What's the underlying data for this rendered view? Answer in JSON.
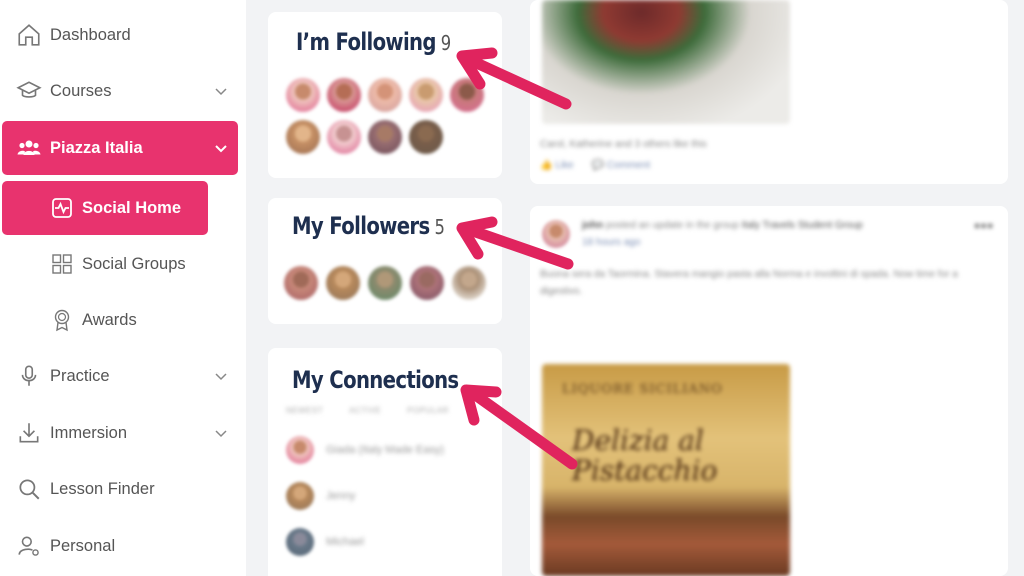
{
  "sidebar": {
    "items": [
      {
        "label": "Dashboard"
      },
      {
        "label": "Courses"
      },
      {
        "label": "Piazza Italia"
      },
      {
        "label": "Social Home"
      },
      {
        "label": "Social Groups"
      },
      {
        "label": "Awards"
      },
      {
        "label": "Practice"
      },
      {
        "label": "Immersion"
      },
      {
        "label": "Lesson Finder"
      },
      {
        "label": "Personal"
      }
    ]
  },
  "widgets": {
    "following": {
      "title": "I’m Following",
      "count": "9"
    },
    "followers": {
      "title": "My Followers",
      "count": "5"
    },
    "connections": {
      "title": "My Connections",
      "tabs": [
        "NEWEST",
        "ACTIVE",
        "POPULAR"
      ],
      "members": [
        "Giada (Italy Made Easy)",
        "Jenny",
        "Michael"
      ]
    }
  },
  "feed": {
    "post1": {
      "likes_text": "Carol, Katherine and 3 others like this",
      "like_label": "Like",
      "comment_label": "Comment"
    },
    "post2": {
      "author": "john",
      "action": "posted an update in the group",
      "group": "Italy Travels Student Group",
      "time": "18 hours ago",
      "body": "Buona sera da Taormina. Stavera mangio pasta alla Norma e involtini di spada. Now time for a digestivo.",
      "photo_label_top": "LIQUORE SICILIANO",
      "photo_label_script": "Delizia al Pistacchio"
    }
  },
  "colors": {
    "accent": "#e8336e",
    "title": "#1e2f4f",
    "arrow": "#e0245e"
  }
}
